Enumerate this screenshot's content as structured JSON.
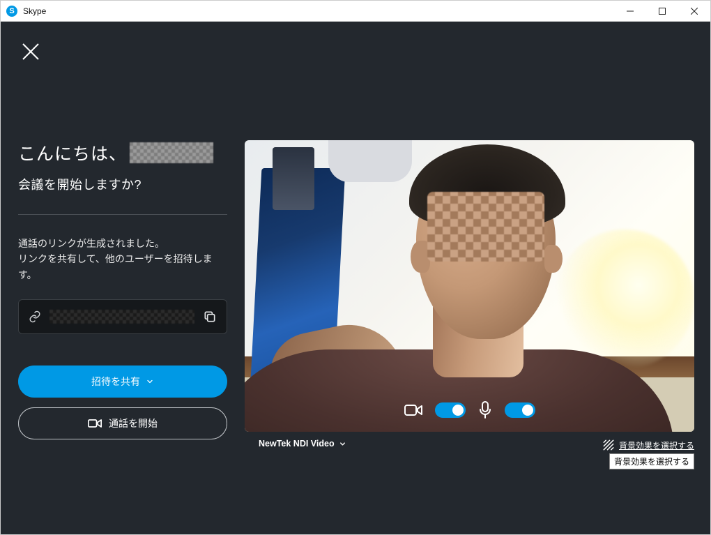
{
  "window": {
    "title": "Skype"
  },
  "greeting": {
    "hello": "こんにちは、",
    "subtitle": "会議を開始しますか?"
  },
  "link_section": {
    "info_line1": "通話のリンクが生成されました。",
    "info_line2": "リンクを共有して、他のユーザーを招待します。"
  },
  "buttons": {
    "share_invite": "招待を共有",
    "start_call": "通話を開始"
  },
  "video": {
    "camera_name": "NewTek NDI Video",
    "bg_effect_label": "背景効果を選択する",
    "bg_effect_tooltip": "背景効果を選択する",
    "camera_toggle": true,
    "mic_toggle": true
  },
  "colors": {
    "accent": "#0099e5"
  }
}
